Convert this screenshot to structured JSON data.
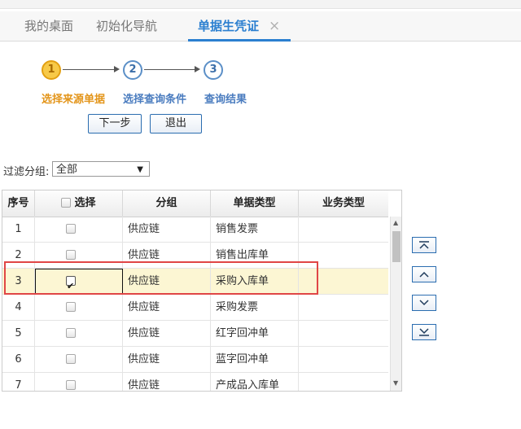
{
  "tabs": [
    {
      "label": "我的桌面"
    },
    {
      "label": "初始化导航"
    },
    {
      "label": "单据生凭证",
      "close": "×"
    }
  ],
  "steps": [
    {
      "number": "1",
      "label": "选择来源单据"
    },
    {
      "number": "2",
      "label": "选择查询条件"
    },
    {
      "number": "3",
      "label": "查询结果"
    }
  ],
  "buttons": {
    "next": "下一步",
    "exit": "退出"
  },
  "filter": {
    "label": "过滤分组:",
    "value": "全部"
  },
  "grid": {
    "headers": {
      "seq": "序号",
      "select": "选择",
      "group": "分组",
      "doc_type": "单据类型",
      "biz_type": "业务类型"
    },
    "rows": [
      {
        "seq": "1",
        "checked": false,
        "group": "供应链",
        "doc_type": "销售发票",
        "biz_type": ""
      },
      {
        "seq": "2",
        "checked": false,
        "group": "供应链",
        "doc_type": "销售出库单",
        "biz_type": ""
      },
      {
        "seq": "3",
        "checked": true,
        "group": "供应链",
        "doc_type": "采购入库单",
        "biz_type": ""
      },
      {
        "seq": "4",
        "checked": false,
        "group": "供应链",
        "doc_type": "采购发票",
        "biz_type": ""
      },
      {
        "seq": "5",
        "checked": false,
        "group": "供应链",
        "doc_type": "红字回冲单",
        "biz_type": ""
      },
      {
        "seq": "6",
        "checked": false,
        "group": "供应链",
        "doc_type": "蓝字回冲单",
        "biz_type": ""
      },
      {
        "seq": "7",
        "checked": false,
        "group": "供应链",
        "doc_type": "产成品入库单",
        "biz_type": ""
      }
    ]
  },
  "side_buttons": [
    "move-top-icon",
    "move-up-icon",
    "move-down-icon",
    "move-bottom-icon"
  ],
  "colors": {
    "accent": "#2b7fd0",
    "step_current": "#e3951a",
    "highlight": "#e04646",
    "selected_row": "#fcf6d3"
  }
}
